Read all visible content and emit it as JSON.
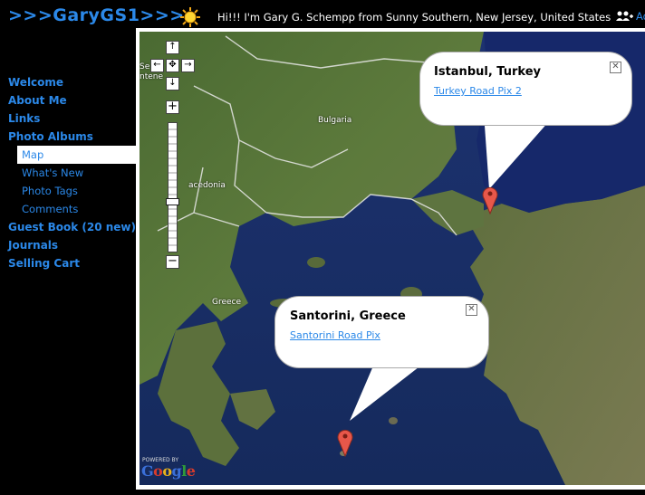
{
  "header": {
    "title": ">>>GaryGS1>>>",
    "greeting": "Hi!!! I'm Gary G. Schempp from Sunny Southern, New Jersey, United States",
    "add_link": "Ad"
  },
  "nav": {
    "welcome": "Welcome",
    "about": "About Me",
    "links": "Links",
    "photo_albums": "Photo Albums",
    "map": "Map",
    "whats_new": "What's New",
    "photo_tags": "Photo Tags",
    "comments": "Comments",
    "guest_book": "Guest Book (20 new)",
    "journals": "Journals",
    "selling_cart": "Selling Cart"
  },
  "map": {
    "labels": {
      "bulgaria": "Bulgaria",
      "macedonia": "acedonia",
      "greece": "Greece",
      "montenegro_1": "Se",
      "montenegro_2": "ntene"
    },
    "controls": {
      "pan_up": "↑",
      "pan_left": "←",
      "pan_center": "✥",
      "pan_right": "→",
      "pan_down": "↓",
      "zoom_in": "+",
      "zoom_out": "−"
    },
    "info_windows": [
      {
        "title": "Istanbul, Turkey",
        "link": "Turkey Road Pix 2"
      },
      {
        "title": "Santorini, Greece",
        "link": "Santorini Road Pix"
      }
    ],
    "close_glyph": "✕",
    "powered_by": "POWERED BY",
    "google_letters": [
      "G",
      "o",
      "o",
      "g",
      "l",
      "e"
    ],
    "google_colors": [
      "#3a6fd8",
      "#d83b2b",
      "#e8b21a",
      "#3a6fd8",
      "#2f9a3a",
      "#d83b2b"
    ]
  },
  "colors": {
    "link": "#2b88e8",
    "marker": "#e8574a"
  }
}
